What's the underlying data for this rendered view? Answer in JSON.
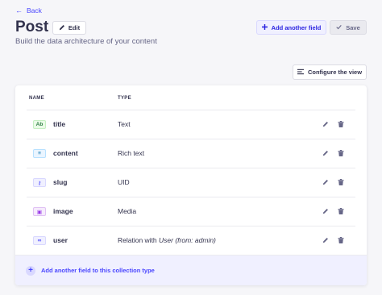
{
  "nav": {
    "back_label": "Back"
  },
  "header": {
    "title": "Post",
    "edit_label": "Edit",
    "subtitle": "Build the data architecture of your content",
    "add_field_label": "Add another field",
    "save_label": "Save"
  },
  "toolbar": {
    "configure_label": "Configure the view"
  },
  "table": {
    "columns": [
      "NAME",
      "TYPE"
    ],
    "rows": [
      {
        "name": "title",
        "type": "Text",
        "icon": "text-type-icon",
        "badge": "Ab",
        "color": "#328048",
        "bg": "#eafbe7",
        "border": "#c6f0c2"
      },
      {
        "name": "content",
        "type": "Rich text",
        "icon": "richtext-type-icon",
        "badge": "≡",
        "color": "#0c75af",
        "bg": "#eaf5ff",
        "border": "#b8e1ff"
      },
      {
        "name": "slug",
        "type": "UID",
        "icon": "key-icon",
        "badge": "⚷",
        "color": "#4945ff",
        "bg": "#f0f0ff",
        "border": "#d9d8ff"
      },
      {
        "name": "image",
        "type": "Media",
        "icon": "media-type-icon",
        "badge": "▣",
        "color": "#9736e8",
        "bg": "#f6ecfc",
        "border": "#e0c1f4"
      },
      {
        "name": "user",
        "type": "Relation with ",
        "type_target": "User (from: admin)",
        "icon": "relation-type-icon",
        "badge": "∞",
        "color": "#4945ff",
        "bg": "#f0f0ff",
        "border": "#d9d8ff"
      }
    ]
  },
  "footer": {
    "add_label": "Add another field to this collection type"
  },
  "colors": {
    "accent": "#4945ff",
    "text": "#32324d",
    "muted": "#666687",
    "page_bg": "#f6f6f9"
  }
}
